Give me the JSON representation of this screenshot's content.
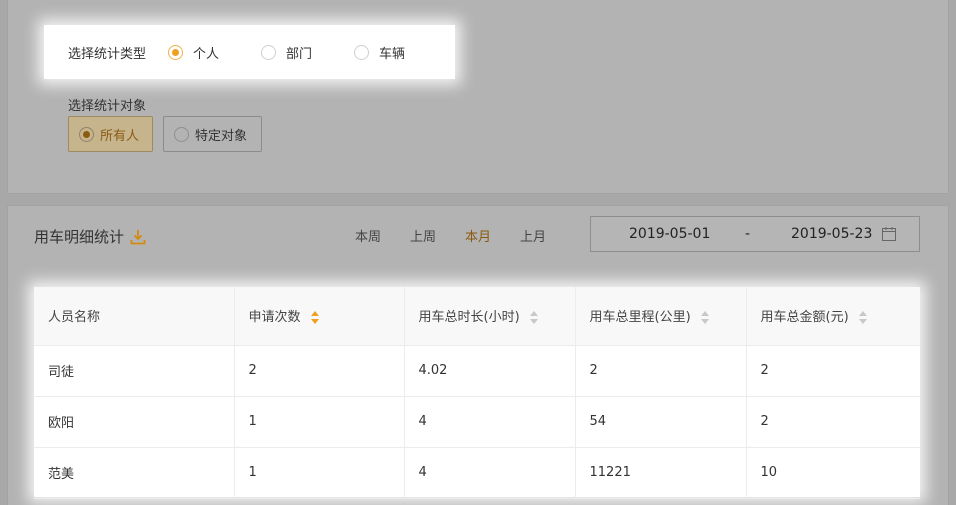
{
  "stat_type": {
    "label": "选择统计类型",
    "options": [
      {
        "label": "个人",
        "selected": true
      },
      {
        "label": "部门",
        "selected": false
      },
      {
        "label": "车辆",
        "selected": false
      }
    ]
  },
  "stat_target": {
    "label": "选择统计对象",
    "options": [
      {
        "label": "所有人",
        "selected": true
      },
      {
        "label": "特定对象",
        "selected": false
      }
    ]
  },
  "detail": {
    "title": "用车明细统计",
    "download_icon": "download-icon",
    "periods": [
      {
        "label": "本周",
        "active": false
      },
      {
        "label": "上周",
        "active": false
      },
      {
        "label": "本月",
        "active": true
      },
      {
        "label": "上月",
        "active": false
      }
    ],
    "date_start": "2019-05-01",
    "date_sep": "-",
    "date_end": "2019-05-23",
    "calendar_icon": "calendar-icon"
  },
  "table": {
    "headers": [
      {
        "label": "人员名称",
        "sortable": false
      },
      {
        "label": "申请次数",
        "sortable": true,
        "active": true
      },
      {
        "label": "用车总时长(小时)",
        "sortable": true,
        "active": false
      },
      {
        "label": "用车总里程(公里)",
        "sortable": true,
        "active": false
      },
      {
        "label": "用车总金额(元)",
        "sortable": true,
        "active": false
      }
    ],
    "rows": [
      [
        "司徒",
        "2",
        "4.02",
        "2",
        "2"
      ],
      [
        "欧阳",
        "1",
        "4",
        "54",
        "2"
      ],
      [
        "范美",
        "1",
        "4",
        "11221",
        "10"
      ]
    ]
  },
  "colors": {
    "accent": "#f0a020",
    "overlay": "#a8a8a8",
    "highlight": "#ffffff"
  }
}
